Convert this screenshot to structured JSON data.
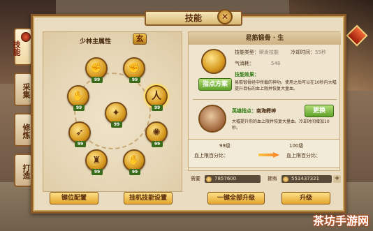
{
  "window": {
    "title": "技能",
    "close_glyph": "✕"
  },
  "tabs": [
    {
      "label": "技能",
      "active": true
    },
    {
      "label": "采集",
      "active": false
    },
    {
      "label": "修炼",
      "active": false
    },
    {
      "label": "打造",
      "active": false
    }
  ],
  "tree": {
    "title": "少林主属性",
    "emblem": "玄",
    "skills": [
      {
        "name": "fist-skill",
        "level": "99"
      },
      {
        "name": "heavy-fist-skill",
        "level": "99"
      },
      {
        "name": "palm-skill",
        "level": "99"
      },
      {
        "name": "body-skill",
        "level": "99"
      },
      {
        "name": "focus-skill",
        "level": "99"
      },
      {
        "name": "dash-skill",
        "level": "99"
      },
      {
        "name": "whirl-skill",
        "level": "99"
      },
      {
        "name": "stance-skill",
        "level": "99"
      },
      {
        "name": "claw-skill",
        "level": "99"
      }
    ]
  },
  "detail": {
    "skill_title": "易筋锻骨 · 生",
    "skill_type_label": "技能类型：",
    "skill_type_value": "瞬发技能",
    "cooldown_label": "冷却时间：",
    "cooldown_value": "55秒",
    "qi_label": "气消耗：",
    "qi_value": "548",
    "effect_header": "技能效果：",
    "effect_text": "易筋锻骨经中所载的神功，使用之后可以在10秒内大幅提升目标的血上限并恢复大量血。",
    "plan_button": "指点方案",
    "hero_label": "英雄指点：",
    "hero_name": "南海鳄神",
    "replace_button": "更换",
    "hero_text": "大幅提升你的血上限并恢复大量血，冷却时间增加10秒。"
  },
  "compare": {
    "current_level": "99级",
    "next_level": "100级",
    "current_stat_label": "血上限百分比：",
    "next_stat_label": "血上限百分比："
  },
  "costs": {
    "need_label": "需要",
    "need_value": "7857600",
    "have_label": "拥有",
    "have_value": "551437321",
    "plus_glyph": "+"
  },
  "buttons": {
    "reset": "键位配置",
    "auto_settings": "挂机技能设置",
    "upgrade_all": "一键全部升级",
    "upgrade": "升级"
  },
  "watermark": "茶坊手游网"
}
